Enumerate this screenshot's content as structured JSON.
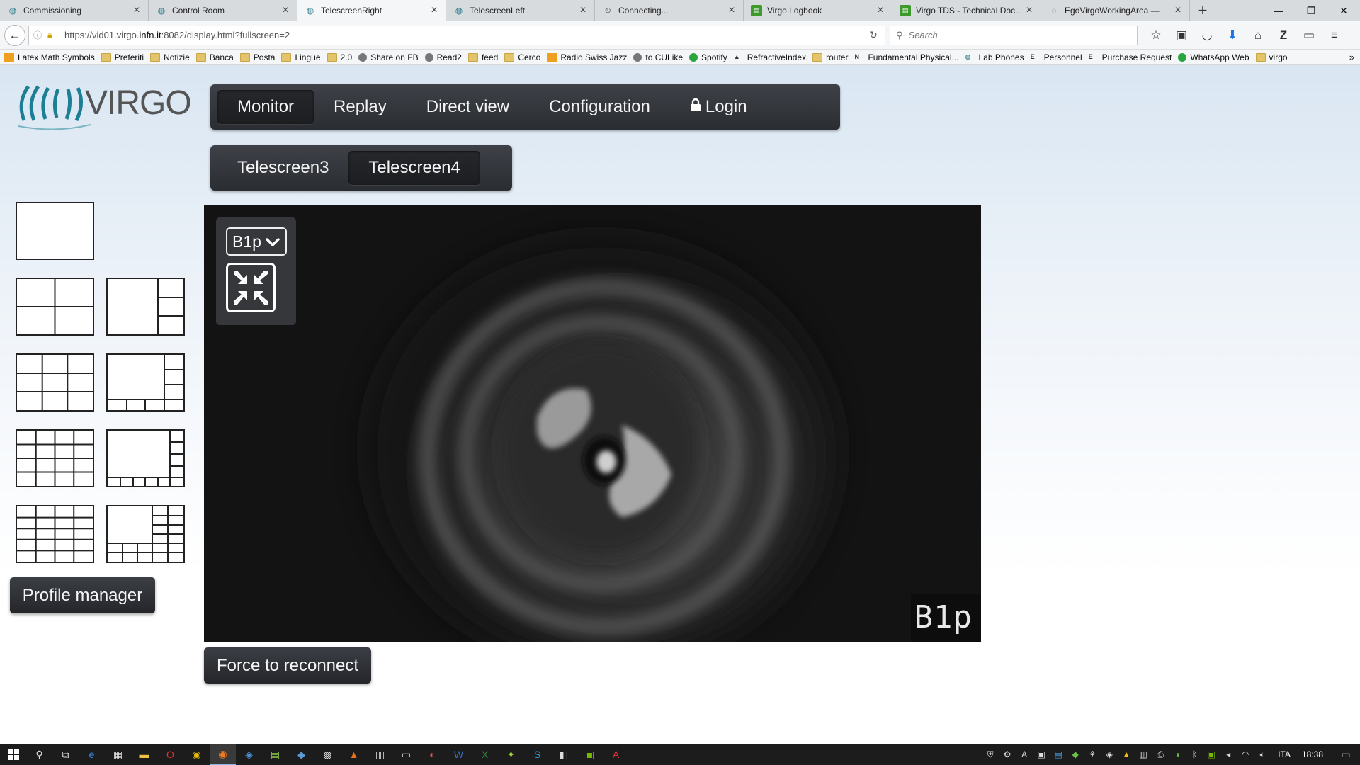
{
  "browser": {
    "tabs": [
      {
        "title": "Commissioning",
        "icon": "virgo-icon"
      },
      {
        "title": "Control Room",
        "icon": "virgo-icon"
      },
      {
        "title": "TelescreenRight",
        "icon": "virgo-icon",
        "active": true
      },
      {
        "title": "TelescreenLeft",
        "icon": "virgo-icon"
      },
      {
        "title": "Connecting...",
        "icon": "loading-icon"
      },
      {
        "title": "Virgo Logbook",
        "icon": "logbook-icon"
      },
      {
        "title": "Virgo TDS - Technical Doc...",
        "icon": "logbook-icon"
      },
      {
        "title": "EgoVirgoWorkingArea —",
        "icon": "wiki-icon"
      }
    ],
    "url_prefix": "https://vid01.virgo.",
    "url_domain": "infn.it",
    "url_suffix": ":8082/display.html?fullscreen=2",
    "search_placeholder": "Search",
    "bookmarks": [
      {
        "label": "Latex Math Symbols",
        "icon": "bookmark-icon"
      },
      {
        "label": "Preferiti",
        "icon": "folder-icon"
      },
      {
        "label": "Notizie",
        "icon": "folder-icon"
      },
      {
        "label": "Banca",
        "icon": "folder-icon"
      },
      {
        "label": "Posta",
        "icon": "folder-icon"
      },
      {
        "label": "Lingue",
        "icon": "folder-icon"
      },
      {
        "label": "2.0",
        "icon": "folder-icon"
      },
      {
        "label": "Share on FB",
        "icon": "globe-icon"
      },
      {
        "label": "Read2",
        "icon": "globe-icon"
      },
      {
        "label": "feed",
        "icon": "folder-icon"
      },
      {
        "label": "Cerco",
        "icon": "folder-icon"
      },
      {
        "label": "Radio Swiss Jazz",
        "icon": "radio-icon"
      },
      {
        "label": "to CULike",
        "icon": "globe-icon"
      },
      {
        "label": "Spotify",
        "icon": "spotify-icon"
      },
      {
        "label": "RefractiveIndex",
        "icon": "refractive-icon"
      },
      {
        "label": "router",
        "icon": "folder-icon"
      },
      {
        "label": "Fundamental Physical...",
        "icon": "nist-icon"
      },
      {
        "label": "Lab Phones",
        "icon": "virgo-icon"
      },
      {
        "label": "Personnel",
        "icon": "ego-icon"
      },
      {
        "label": "Purchase Request",
        "icon": "ego-icon"
      },
      {
        "label": "WhatsApp Web",
        "icon": "whatsapp-icon"
      },
      {
        "label": "virgo",
        "icon": "folder-icon"
      }
    ]
  },
  "app": {
    "logo_text": "VIRGO",
    "main_nav": [
      {
        "label": "Monitor",
        "active": true
      },
      {
        "label": "Replay"
      },
      {
        "label": "Direct view"
      },
      {
        "label": "Configuration"
      },
      {
        "label": "Login",
        "icon": "lock-icon"
      }
    ],
    "sub_nav": [
      {
        "label": "Telescreen3"
      },
      {
        "label": "Telescreen4",
        "active": true
      }
    ],
    "layouts": [
      "layout-1x1",
      "layout-2x2",
      "layout-1-plus-3",
      "layout-3x3",
      "layout-1-plus-5",
      "layout-4x4",
      "layout-1-plus-7",
      "layout-5x4",
      "layout-1-plus-9"
    ],
    "profile_manager_label": "Profile manager",
    "reconnect_label": "Force to reconnect",
    "video": {
      "camera": "B1p",
      "overlay_label": "B1p"
    }
  },
  "taskbar": {
    "language": "ITA",
    "time": "18:38"
  }
}
